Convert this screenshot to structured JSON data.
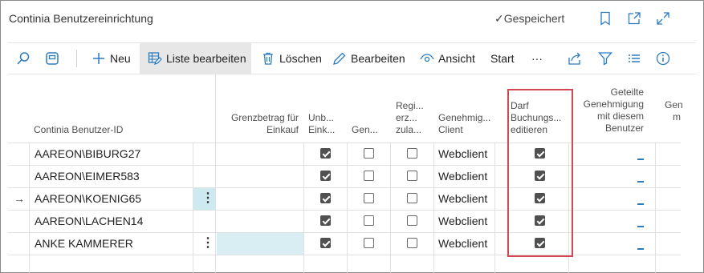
{
  "header": {
    "title": "Continia Benutzereinrichtung",
    "saved_label": "Gespeichert",
    "icons": [
      "bookmark-icon",
      "open-new-window-icon",
      "expand-icon"
    ]
  },
  "toolbar": {
    "search_icon": "search-icon",
    "layout_icon": "layout-icon",
    "new_label": "Neu",
    "edit_list_label": "Liste bearbeiten",
    "delete_label": "Löschen",
    "edit_label": "Bearbeiten",
    "view_label": "Ansicht",
    "start_label": "Start",
    "more_label": "···",
    "right_icons": [
      "share-icon",
      "filter-icon",
      "list-view-icon",
      "info-icon"
    ]
  },
  "columns": {
    "user_id": "Continia Benutzer-ID",
    "limit": [
      "Grenzbetrag für",
      "Einkauf"
    ],
    "unb": [
      "Unb...",
      "Eink..."
    ],
    "gen": "Gen...",
    "reg": [
      "Regi...",
      "erz...",
      "zula..."
    ],
    "client": [
      "Genehmig...",
      "Client"
    ],
    "darf": [
      "Darf",
      "Buchungs...",
      "editieren"
    ],
    "geteilte": [
      "Geteilte",
      "Genehmigung",
      "mit diesem",
      "Benutzer"
    ],
    "partial": [
      "Gen",
      "m"
    ]
  },
  "rows": [
    {
      "user": "AAREON\\BIBURG27",
      "unb": true,
      "gen": false,
      "reg": false,
      "client": "Webclient",
      "darf": true,
      "geteilte": "_",
      "current": false
    },
    {
      "user": "AAREON\\EIMER583",
      "unb": true,
      "gen": false,
      "reg": false,
      "client": "Webclient",
      "darf": true,
      "geteilte": "_",
      "current": false
    },
    {
      "user": "AAREON\\KOENIG65",
      "unb": true,
      "gen": false,
      "reg": false,
      "client": "Webclient",
      "darf": true,
      "geteilte": "_",
      "current": true
    },
    {
      "user": "AAREON\\LACHEN14",
      "unb": true,
      "gen": false,
      "reg": false,
      "client": "Webclient",
      "darf": true,
      "geteilte": "_",
      "current": false
    },
    {
      "user": "ANKE KAMMERER",
      "unb": true,
      "gen": false,
      "reg": false,
      "client": "Webclient",
      "darf": true,
      "geteilte": "_",
      "current": false
    }
  ],
  "row_arrow": "→",
  "kebab": "⋮",
  "colors": {
    "accent": "#2b7bbf",
    "highlight": "#d9eef2",
    "red_box": "#d64550"
  }
}
